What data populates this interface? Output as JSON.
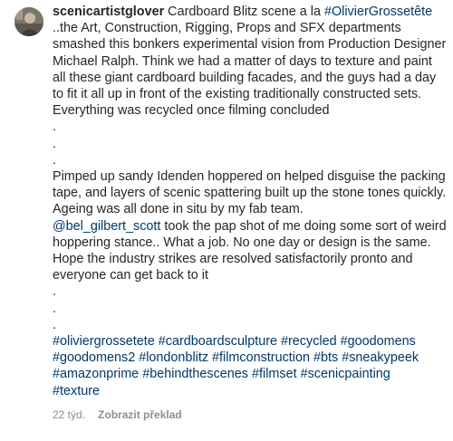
{
  "comment": {
    "username": "scenicartistglover",
    "paragraph1": {
      "text_a": " Cardboard Blitz scene a la ",
      "mention_a": "#OlivierGrossetête",
      "text_b": "\n..the Art, Construction, Rigging, Props and SFX departments smashed this bonkers experimental vision from Production Designer Michael Ralph. Think we had a matter of days to texture and paint all these giant cardboard building facades, and the guys had a day to fit it all up in front of the existing traditionally constructed sets. Everything was recycled once filming concluded\n.\n.\n.\nPimped up sandy Idenden hoppered on helped disguise the packing tape, and layers of scenic spattering built up the stone tones quickly. Ageing was all done in situ by my fab team.\n",
      "mention_b": "@bel_gilbert_scott",
      "text_c": " took the pap shot of me doing some sort of weird hoppering stance.. What a job. No one day or design is the same. Hope the industry strikes are resolved satisfactorily pronto and everyone can get back to it\n.\n.\n.\n"
    },
    "hashtags": [
      "#oliviergrossetete",
      "#cardboardsculpture",
      "#recycled",
      "#goodomens",
      "#goodomens2",
      "#londonblitz",
      "#filmconstruction",
      "#bts",
      "#sneakypeek",
      "#amazonprime",
      "#behindthescenes",
      "#filmset",
      "#scenicpainting",
      "#texture"
    ],
    "time_ago": "22 týd.",
    "translate_label": "Zobrazit překlad"
  },
  "colors": {
    "text": "#262626",
    "link": "#00376b",
    "muted": "#8e8e8e"
  }
}
